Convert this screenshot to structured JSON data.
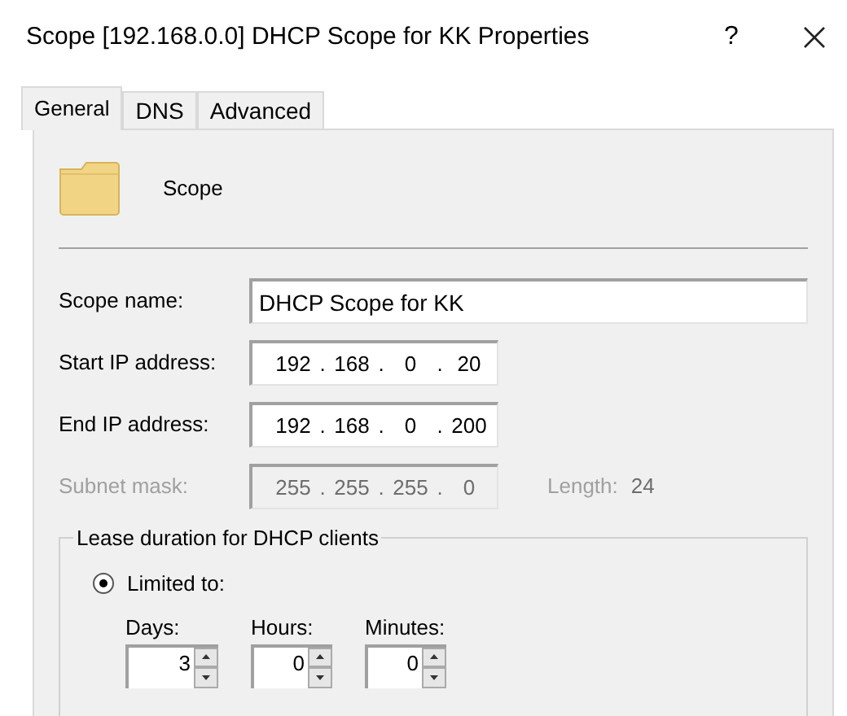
{
  "window": {
    "title": "Scope [192.168.0.0] DHCP Scope for KK Properties",
    "help": "?"
  },
  "tabs": [
    {
      "label": "General",
      "selected": true
    },
    {
      "label": "DNS",
      "selected": false
    },
    {
      "label": "Advanced",
      "selected": false
    }
  ],
  "header": {
    "label": "Scope"
  },
  "scope_name": {
    "label": "Scope name:",
    "value": "DHCP Scope for KK"
  },
  "ip_fields": [
    {
      "label": "Start IP address:",
      "octets": [
        "192",
        "168",
        "0",
        "20"
      ],
      "separator": ".",
      "disabled": false
    },
    {
      "label": "End IP address:",
      "octets": [
        "192",
        "168",
        "0",
        "200"
      ],
      "separator": ".",
      "disabled": false
    },
    {
      "label": "Subnet mask:",
      "octets": [
        "255",
        "255",
        "255",
        "0"
      ],
      "separator": ".",
      "disabled": true
    }
  ],
  "length": {
    "label": "Length:",
    "value": "24"
  },
  "lease": {
    "title": "Lease duration for DHCP clients",
    "option": {
      "label": "Limited to:",
      "selected": true
    },
    "spinners": [
      {
        "label": "Days:",
        "value": "3"
      },
      {
        "label": "Hours:",
        "value": "0"
      },
      {
        "label": "Minutes:",
        "value": "0"
      }
    ]
  }
}
